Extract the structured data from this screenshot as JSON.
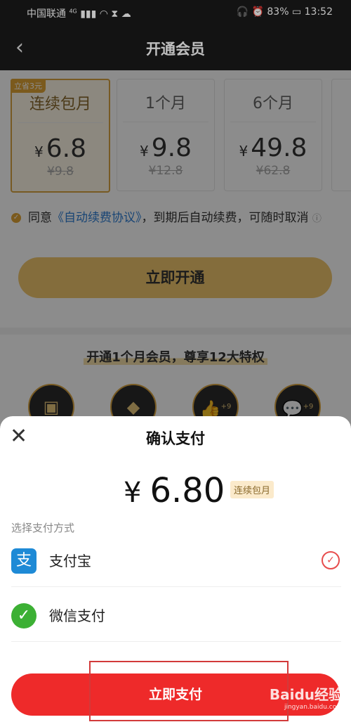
{
  "status": {
    "carrier": "中国联通",
    "signal": "4G",
    "battery": "83%",
    "time": "13:52"
  },
  "nav": {
    "back_icon": "‹",
    "title": "开通会员"
  },
  "plans": [
    {
      "name": "连续包月",
      "price": "6.8",
      "original": "¥9.8",
      "tag": "立省3元",
      "selected": true
    },
    {
      "name": "1个月",
      "price": "9.8",
      "original": "¥12.8"
    },
    {
      "name": "6个月",
      "price": "49.8",
      "original": "¥62.8"
    }
  ],
  "currency": "¥",
  "agreement": {
    "prefix": "同意",
    "link": "《自动续费协议》",
    "suffix": "，到期后自动续费，可随时取消"
  },
  "open_button": "立即开通",
  "privileges_title": "开通1个月会员，尊享12大特权",
  "privilege_badges": [
    "+9",
    "+9"
  ],
  "sheet": {
    "title": "确认支付",
    "amount": "6.80",
    "amount_tag": "连续包月",
    "choose_label": "选择支付方式",
    "methods": [
      {
        "label": "支付宝",
        "icon": "alipay-icon",
        "selected": true
      },
      {
        "label": "微信支付",
        "icon": "wechat-pay-icon",
        "selected": false
      }
    ],
    "pay_button": "立即支付"
  },
  "watermark": {
    "brand": "Baidu经验",
    "url": "jingyan.baidu.com"
  },
  "colors": {
    "accent_gold": "#e0a436",
    "pay_red": "#ee2a2a",
    "link_blue": "#2f7fd6"
  }
}
